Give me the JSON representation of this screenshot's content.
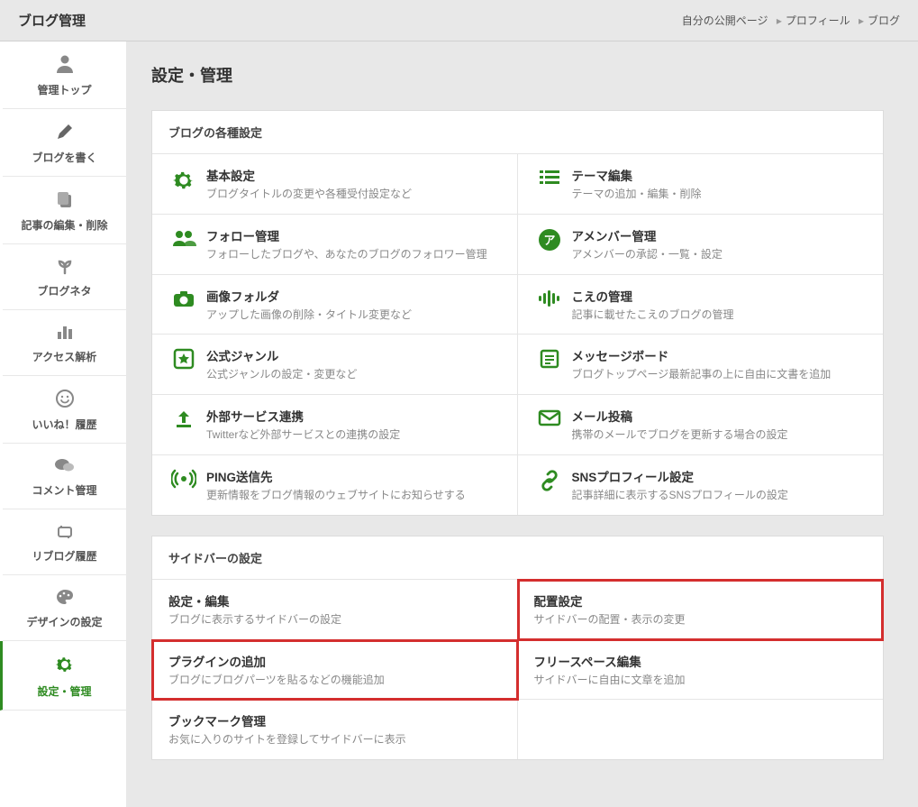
{
  "topbar": {
    "title": "ブログ管理",
    "links_label": "自分の公開ページ",
    "link_profile": "プロフィール",
    "link_blog": "ブログ"
  },
  "sidebar": [
    {
      "label": "管理トップ"
    },
    {
      "label": "ブログを書く"
    },
    {
      "label": "記事の編集・削除"
    },
    {
      "label": "ブログネタ"
    },
    {
      "label": "アクセス解析"
    },
    {
      "label": "いいね！履歴"
    },
    {
      "label": "コメント管理"
    },
    {
      "label": "リブログ履歴"
    },
    {
      "label": "デザインの設定"
    },
    {
      "label": "設定・管理"
    }
  ],
  "page_heading": "設定・管理",
  "section_blog": {
    "header": "ブログの各種設定",
    "items": [
      {
        "title": "基本設定",
        "desc": "ブログタイトルの変更や各種受付設定など"
      },
      {
        "title": "テーマ編集",
        "desc": "テーマの追加・編集・削除"
      },
      {
        "title": "フォロー管理",
        "desc": "フォローしたブログや、あなたのブログのフォロワー管理"
      },
      {
        "title": "アメンバー管理",
        "desc": "アメンバーの承認・一覧・設定"
      },
      {
        "title": "画像フォルダ",
        "desc": "アップした画像の削除・タイトル変更など"
      },
      {
        "title": "こえの管理",
        "desc": "記事に載せたこえのブログの管理"
      },
      {
        "title": "公式ジャンル",
        "desc": "公式ジャンルの設定・変更など"
      },
      {
        "title": "メッセージボード",
        "desc": "ブログトップページ最新記事の上に自由に文書を追加"
      },
      {
        "title": "外部サービス連携",
        "desc": "Twitterなど外部サービスとの連携の設定"
      },
      {
        "title": "メール投稿",
        "desc": "携帯のメールでブログを更新する場合の設定"
      },
      {
        "title": "PING送信先",
        "desc": "更新情報をブログ情報のウェブサイトにお知らせする"
      },
      {
        "title": "SNSプロフィール設定",
        "desc": "記事詳細に表示するSNSプロフィールの設定"
      }
    ]
  },
  "section_sidebar": {
    "header": "サイドバーの設定",
    "items": [
      {
        "title": "設定・編集",
        "desc": "ブログに表示するサイドバーの設定"
      },
      {
        "title": "配置設定",
        "desc": "サイドバーの配置・表示の変更"
      },
      {
        "title": "プラグインの追加",
        "desc": "ブログにブログパーツを貼るなどの機能追加"
      },
      {
        "title": "フリースペース編集",
        "desc": "サイドバーに自由に文章を追加"
      },
      {
        "title": "ブックマーク管理",
        "desc": "お気に入りのサイトを登録してサイドバーに表示"
      }
    ]
  }
}
